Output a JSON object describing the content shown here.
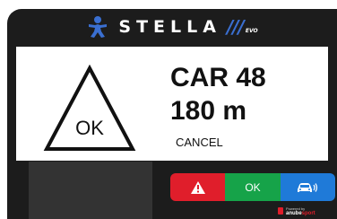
{
  "header": {
    "brand_name": "STELLA",
    "brand_bars": "///",
    "brand_suffix": "EVO"
  },
  "alert": {
    "triangle_label": "OK",
    "vehicle": "CAR 48",
    "distance": "180 m",
    "cancel_label": "CANCEL"
  },
  "buttons": {
    "ok_label": "OK",
    "alarm_icon": "warning-triangle-icon",
    "vehicle_icon": "car-signal-icon"
  },
  "footer": {
    "powered_by": "Powered by",
    "vendor_name": "anube",
    "vendor_accent": "sport"
  },
  "colors": {
    "device_bg": "#1c1c1c",
    "brand_blue": "#3a6fd1",
    "alarm_red": "#e01e2b",
    "ok_green": "#16a349",
    "info_blue": "#1f7ad8",
    "panel_gray": "#333333"
  }
}
